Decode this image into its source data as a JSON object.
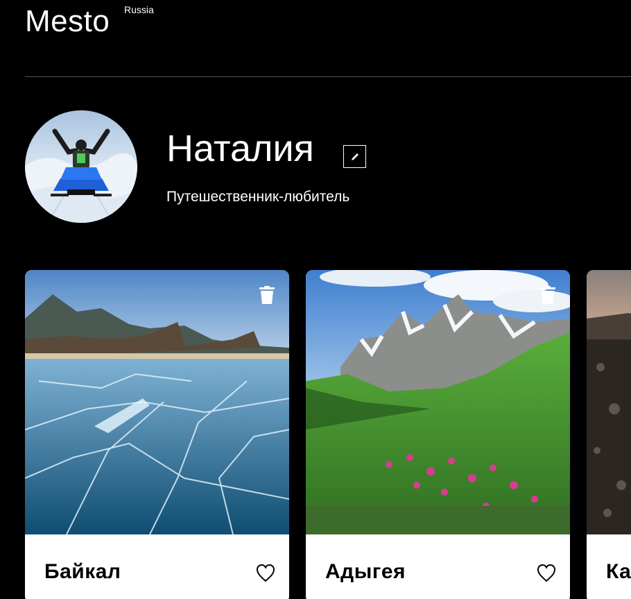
{
  "header": {
    "logo": "Mesto",
    "logo_sub": "Russia"
  },
  "profile": {
    "name": "Наталия",
    "about": "Путешественник-любитель",
    "avatar_alt": "snowmobile rider"
  },
  "cards": [
    {
      "title": "Байкал",
      "image": "frozen-lake-icon"
    },
    {
      "title": "Адыгея",
      "image": "mountains-meadow-icon"
    },
    {
      "title": "Ка",
      "image": "dark-landscape-icon"
    }
  ],
  "colors": {
    "background": "#000000",
    "divider": "#545454",
    "card": "#ffffff",
    "text": "#ffffff"
  }
}
